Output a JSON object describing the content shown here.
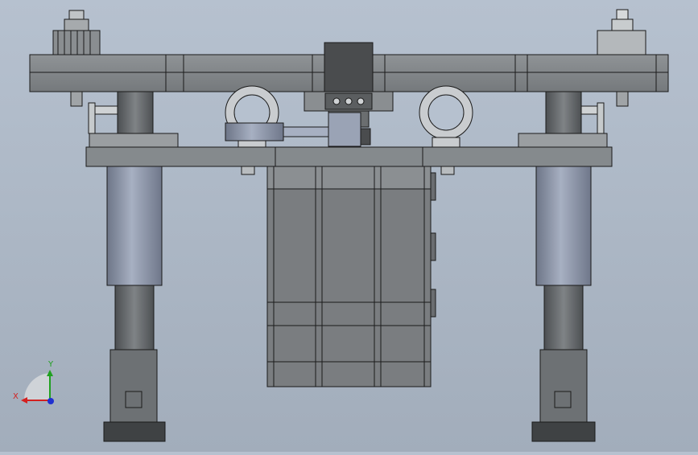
{
  "viewport": {
    "background_top": "#b6c1cf",
    "background_bottom": "#a2adbb"
  },
  "triad": {
    "x_label": "X",
    "y_label": "Y",
    "x_color": "#d42020",
    "y_color": "#20a020",
    "z_color": "#2030d0"
  },
  "model": {
    "body_color": "#808487",
    "motor_color": "#777a7d",
    "cylinder_color": "#9aa3b5",
    "edge_color": "#1a1a1a"
  }
}
